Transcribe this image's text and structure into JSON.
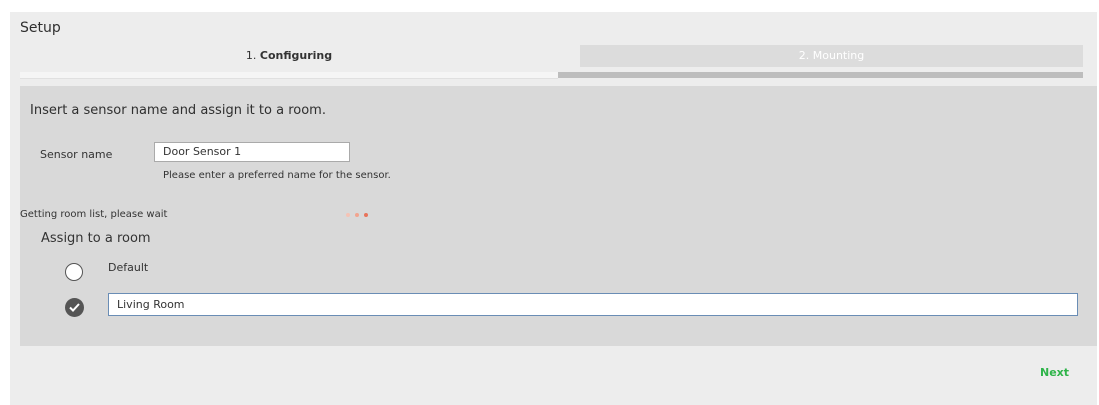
{
  "header": {
    "title": "Setup"
  },
  "steps": [
    {
      "number": "1.",
      "label": "Configuring",
      "active": true
    },
    {
      "number": "2.",
      "label": "Mounting",
      "active": false
    }
  ],
  "form": {
    "intro": "Insert a sensor name and assign it to a room.",
    "sensor_name_label": "Sensor name",
    "sensor_name_value": "Door Sensor 1",
    "sensor_name_hint": "Please enter a preferred name for the sensor.",
    "loading_text": "Getting room list, please wait",
    "assign_title": "Assign to a room",
    "room_options": [
      {
        "label": "Default",
        "selected": false
      },
      {
        "label": "Living Room",
        "selected": true
      }
    ]
  },
  "footer": {
    "next_label": "Next"
  },
  "colors": {
    "next_button": "#2fb44a",
    "loading_dots": [
      "#f5c3b5",
      "#f2a48f",
      "#e8735a"
    ],
    "active_input_border": "#6a8db5"
  },
  "icons": {
    "selected_option": "check-circle-icon",
    "unselected_option": "radio-circle-icon"
  }
}
